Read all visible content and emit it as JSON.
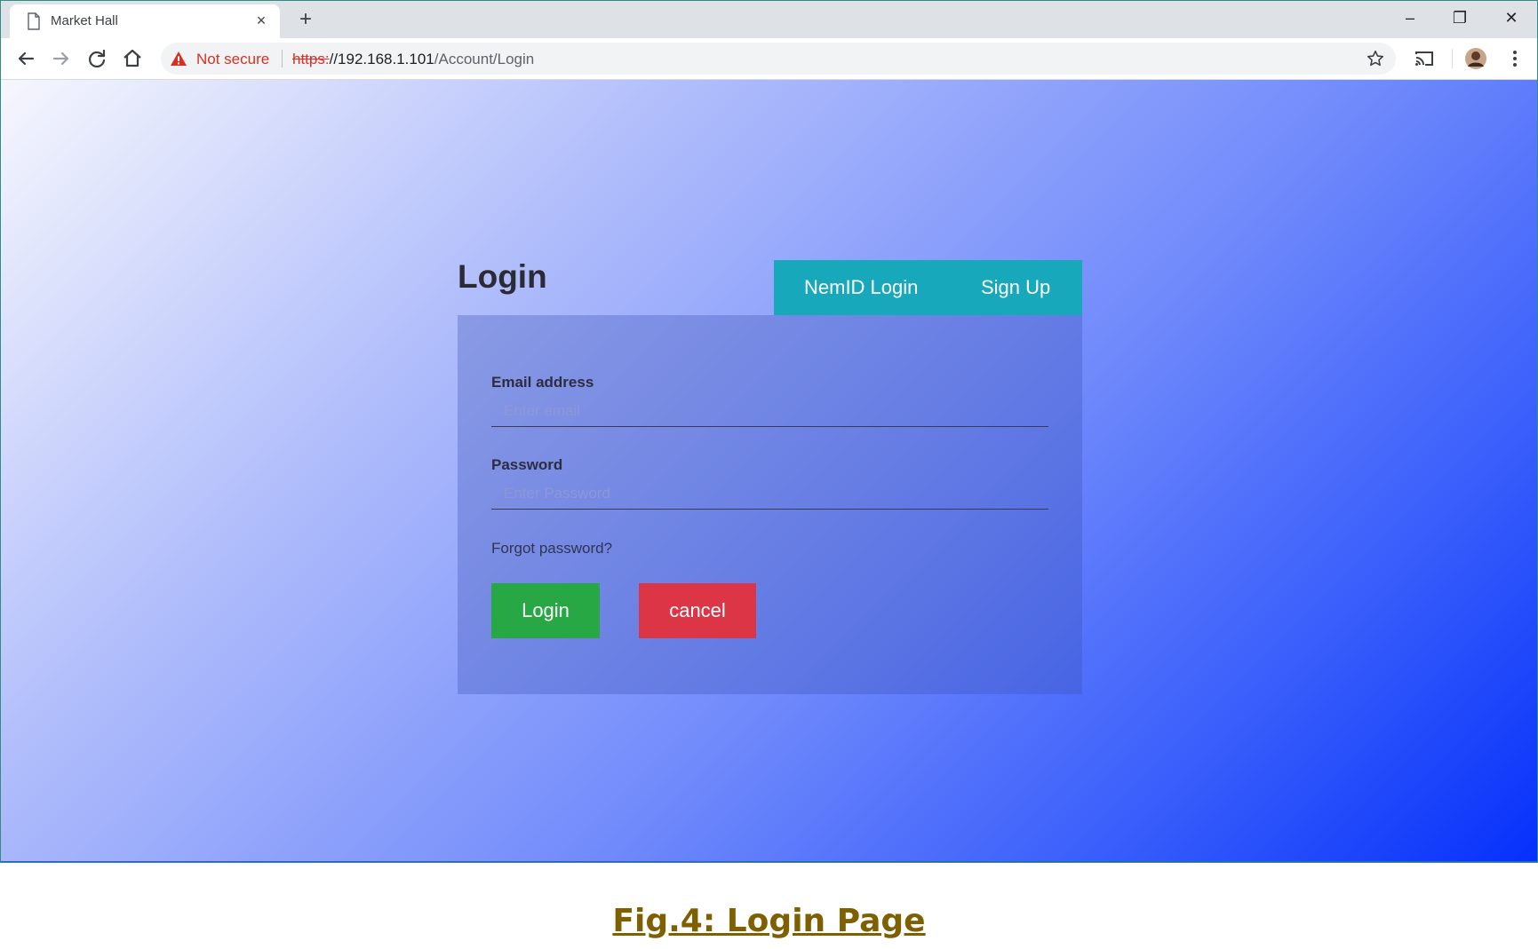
{
  "browser": {
    "tab_title": "Market Hall",
    "tab_close": "×",
    "new_tab": "+",
    "window_controls": {
      "minimize": "–",
      "restore": "❐",
      "close": "✕"
    },
    "security_label": "Not secure",
    "url_scheme": "https:",
    "url_host": "//192.168.1.101",
    "url_path": "/Account/Login",
    "icons": [
      "page-icon",
      "back-icon",
      "forward-icon",
      "reload-icon",
      "home-icon",
      "warning-icon",
      "star-icon",
      "cast-icon",
      "avatar",
      "menu-icon"
    ],
    "colors": {
      "warning": "#d93025",
      "tab_strip": "#dee1e6"
    }
  },
  "page": {
    "heading": "Login",
    "tabs": [
      {
        "label": "NemID Login"
      },
      {
        "label": "Sign Up"
      }
    ],
    "form": {
      "email_label": "Email address",
      "email_placeholder": "Enter email",
      "email_value": "",
      "password_label": "Password",
      "password_placeholder": "Enter Password",
      "password_value": "",
      "forgot_password": "Forgot password?",
      "login_button": "Login",
      "cancel_button": "cancel"
    },
    "colors": {
      "tab_bar": "#17a8bc",
      "login_button": "#28a745",
      "cancel_button": "#dc3545",
      "background_start": "#f6f7fd",
      "background_end": "#0630fb"
    }
  },
  "caption": "Fig.4: Login Page"
}
